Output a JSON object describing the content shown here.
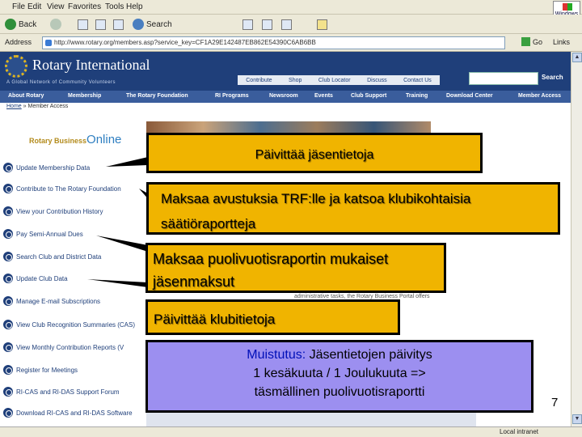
{
  "browser": {
    "menu": [
      "File",
      "Edit",
      "View",
      "Favorites",
      "Tools",
      "Help"
    ],
    "windows_logo_label": "Windows",
    "back_label": "Back",
    "search_label": "Search",
    "address_label": "Address",
    "address_value": "http://www.rotary.org/members.asp?service_key=CF1A29E142487EB862E54390C6AB6BB",
    "go_label": "Go",
    "links_label": "Links",
    "status_zone": "Local intranet"
  },
  "site": {
    "title": "Rotary International",
    "tagline": "A Global Network of Community Volunteers",
    "util_nav": [
      "Contribute",
      "Shop",
      "Club Locator",
      "Discuss",
      "Contact Us"
    ],
    "search_button": "Search",
    "main_nav": [
      "About Rotary",
      "Membership",
      "The Rotary Foundation",
      "RI Programs",
      "Newsroom",
      "Events",
      "Club Support",
      "Training",
      "Download Center",
      "Member Access"
    ],
    "breadcrumb_home": "Home",
    "breadcrumb_current": "Member Access",
    "business_online_prefix": "Rotary Business",
    "business_online_suffix": "Online",
    "page_info_text": "administrative tasks, the Rotary Business Portal offers",
    "sidebar": [
      "Update Membership Data",
      "Contribute to The Rotary Foundation",
      "View your Contribution History",
      "Pay Semi-Annual Dues",
      "Search Club and District Data",
      "Update Club Data",
      "Manage E-mail Subscriptions",
      "View Club Recognition Summaries (CAS)",
      "View Monthly Contribution Reports (V",
      "Register for Meetings",
      "RI-CAS and RI-DAS Support Forum",
      "Download RI-CAS and RI-DAS Software"
    ]
  },
  "callouts": {
    "update_member": "Päivittää jäsentietoja",
    "trf_line1": "Maksaa avustuksia TRF:lle ja katsoa klubikohtaisia",
    "trf_line2": "säätiöraportteja",
    "dues_line1": "Maksaa puolivuotisraportin mukaiset",
    "dues_line2": "jäsenmaksut",
    "club_update": "Päivittää klubitietoja"
  },
  "reminder": {
    "label": "Muistutus:",
    "line1_rest": " Jäsentietojen päivitys",
    "line2": "1 kesäkuuta / 1 Joulukuuta =>",
    "line3": "täsmällinen puolivuotisraportti"
  },
  "slide_number": "7",
  "colors": {
    "callout_fill": "#f0b400",
    "reminder_fill": "#9c8ff0",
    "rotary_blue": "#1f3f7a",
    "reminder_label": "#0010b8"
  }
}
